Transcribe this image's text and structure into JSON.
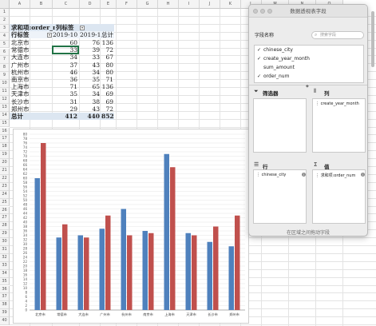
{
  "sheet": {
    "columns": [
      "A",
      "B",
      "C",
      "D",
      "E",
      "F",
      "G",
      "H",
      "I",
      "J",
      "K",
      "L",
      "M",
      "N",
      "O"
    ],
    "rows": [
      "1",
      "2",
      "3",
      "4",
      "5",
      "6",
      "7",
      "8",
      "9",
      "10",
      "11",
      "12",
      "13",
      "14",
      "15",
      "16",
      "17",
      "18",
      "19",
      "20",
      "21",
      "22",
      "23",
      "24",
      "25",
      "26",
      "27",
      "28",
      "29",
      "30",
      "31",
      "32",
      "33",
      "34",
      "35",
      "36",
      "37",
      "38",
      "39",
      "40"
    ]
  },
  "pivot": {
    "value_label": "求和项:order_num",
    "col_label": "列标签",
    "row_label": "行标签",
    "col_headers": [
      "2019-10",
      "2019-11",
      "总计"
    ],
    "rows": [
      {
        "name": "北京市",
        "v1": "60",
        "v2": "76",
        "t": "136"
      },
      {
        "name": "常德市",
        "v1": "33",
        "v2": "39",
        "t": "72"
      },
      {
        "name": "大连市",
        "v1": "34",
        "v2": "33",
        "t": "67"
      },
      {
        "name": "广州市",
        "v1": "37",
        "v2": "43",
        "t": "80"
      },
      {
        "name": "杭州市",
        "v1": "46",
        "v2": "34",
        "t": "80"
      },
      {
        "name": "南京市",
        "v1": "36",
        "v2": "35",
        "t": "71"
      },
      {
        "name": "上海市",
        "v1": "71",
        "v2": "65",
        "t": "136"
      },
      {
        "name": "天津市",
        "v1": "35",
        "v2": "34",
        "t": "69"
      },
      {
        "name": "长沙市",
        "v1": "31",
        "v2": "38",
        "t": "69"
      },
      {
        "name": "郑州市",
        "v1": "29",
        "v2": "43",
        "t": "72"
      }
    ],
    "total": {
      "name": "总计",
      "v1": "412",
      "v2": "440",
      "t": "852"
    }
  },
  "chart_data": {
    "type": "bar",
    "categories": [
      "北京市",
      "常德市",
      "大连市",
      "广州市",
      "杭州市",
      "南京市",
      "上海市",
      "天津市",
      "长沙市",
      "郑州市"
    ],
    "series": [
      {
        "name": "2019-10",
        "values": [
          60,
          33,
          34,
          37,
          46,
          36,
          71,
          35,
          31,
          29
        ],
        "color": "#4f81bd"
      },
      {
        "name": "2019-11",
        "values": [
          76,
          39,
          33,
          43,
          34,
          35,
          65,
          34,
          38,
          43
        ],
        "color": "#c0504d"
      }
    ],
    "ylim": [
      0,
      80
    ],
    "yticks": [
      "0",
      "2",
      "4",
      "6",
      "8",
      "10",
      "12",
      "14",
      "16",
      "18",
      "20",
      "22",
      "24",
      "26",
      "28",
      "30",
      "32",
      "34",
      "36",
      "38",
      "40",
      "42",
      "44",
      "46",
      "48",
      "50",
      "52",
      "54",
      "56",
      "58",
      "60",
      "62",
      "64",
      "66",
      "68",
      "70",
      "72",
      "74",
      "76",
      "78",
      "80"
    ],
    "title": "",
    "xlabel": "",
    "ylabel": ""
  },
  "panel": {
    "title": "数据透视表字段",
    "field_name_label": "字段名称",
    "search_placeholder": "搜索字段",
    "fields": [
      {
        "name": "chinese_city",
        "checked": "✓"
      },
      {
        "name": "create_year_month",
        "checked": "✓"
      },
      {
        "name": "sum_amount",
        "checked": ""
      },
      {
        "name": "order_num",
        "checked": "✓"
      }
    ],
    "filters_label": "筛选器",
    "columns_label": "列",
    "rows_label": "行",
    "values_label": "值",
    "columns_chip": "create_year_month",
    "rows_chip": "chinese_city",
    "values_chip": "求和项:order_num",
    "footer": "在区域之间拖动字段",
    "icons": {
      "filter": "filter-icon",
      "columns": "columns-icon",
      "rows": "rows-icon",
      "values": "sigma-icon"
    }
  }
}
